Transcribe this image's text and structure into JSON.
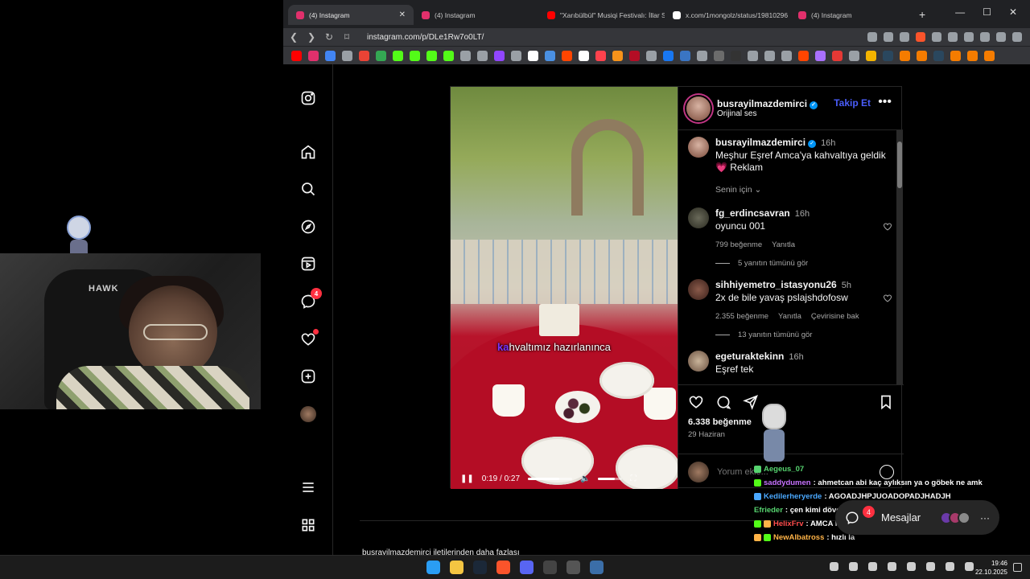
{
  "browser": {
    "tabs": [
      {
        "title": "(4) Instagram",
        "color": "#e1306c",
        "active": true
      },
      {
        "title": "(4) Instagram",
        "color": "#e1306c",
        "active": false
      },
      {
        "title": "\"Xarıbülbül\" Musiqi Festivalı: İllar S",
        "color": "#ff0000",
        "active": false
      },
      {
        "title": "x.com/1mongolz/status/19810296",
        "color": "#ffffff",
        "active": false
      },
      {
        "title": "(4) Instagram",
        "color": "#e1306c",
        "active": false
      }
    ],
    "url": "instagram.com/p/DLe1Rw7o0LT/"
  },
  "instagram": {
    "sidebar": {
      "messages_badge": "4"
    },
    "post": {
      "username": "busrayilmazdemirci",
      "audio": "Orijinal ses",
      "follow_label": "Takip Et",
      "caption_user": "busrayilmazdemirci",
      "caption_time": "16h",
      "caption_text": "Meşhur Eşref Amca'ya kahvaltıya geldik",
      "caption_tag": "💗 Reklam",
      "sort_label": "Senin için",
      "video_caption_pre": "ka",
      "video_caption": "hvaltımız hazırlanınca",
      "video_time": "0:19 / 0:27",
      "video_progress": 0.7,
      "likes": "6.338 beğenme",
      "date": "29 Haziran",
      "comment_placeholder": "Yorum ekle...",
      "comments": [
        {
          "user": "fg_erdincsavran",
          "time": "16h",
          "text": "oyuncu 001",
          "likes": "799 beğenme",
          "reply": "Yanıtla",
          "extra": "",
          "replies": "5 yanıtın tümünü gör"
        },
        {
          "user": "sihhiyemetro_istasyonu26",
          "time": "5h",
          "text": "2x de bile yavaş pslajshdofosw",
          "likes": "2.355 beğenme",
          "reply": "Yanıtla",
          "extra": "Çevirisine bak",
          "replies": "13 yanıtın tümünü gör"
        },
        {
          "user": "egeturaktekinn",
          "time": "16h",
          "text": "Eşref tek",
          "likes": "",
          "reply": "",
          "extra": "",
          "replies": ""
        }
      ]
    },
    "below_text": "busrayilmazdemirci iletilerinden daha fazlası",
    "messages_pill": {
      "label": "Mesajlar",
      "badge": "4"
    }
  },
  "chat": [
    {
      "user": "Aegeus_07",
      "message": "",
      "color": "#56d36f"
    },
    {
      "user": "saddydumen",
      "message": ": ahmetcan abi kaç aylıksın ya o göbek ne amk",
      "color": "#c772ff"
    },
    {
      "user": "Kedilerheryerde",
      "message": ": AGOADJHPJUOADOPADJHADJH",
      "color": "#4aa8ff"
    },
    {
      "user": "Efrieder",
      "message": ": çen kimi dövçen",
      "color": "#56d36f"
    },
    {
      "user": "HelixFrv",
      "message": ": AMCA HADİ HIZLI",
      "color": "#ff4d4d"
    },
    {
      "user": "NewAlbatross",
      "message": ": hızlı la",
      "color": "#ffb347"
    }
  ],
  "taskbar": {
    "time": "19:46",
    "date": "22.10.2025"
  }
}
